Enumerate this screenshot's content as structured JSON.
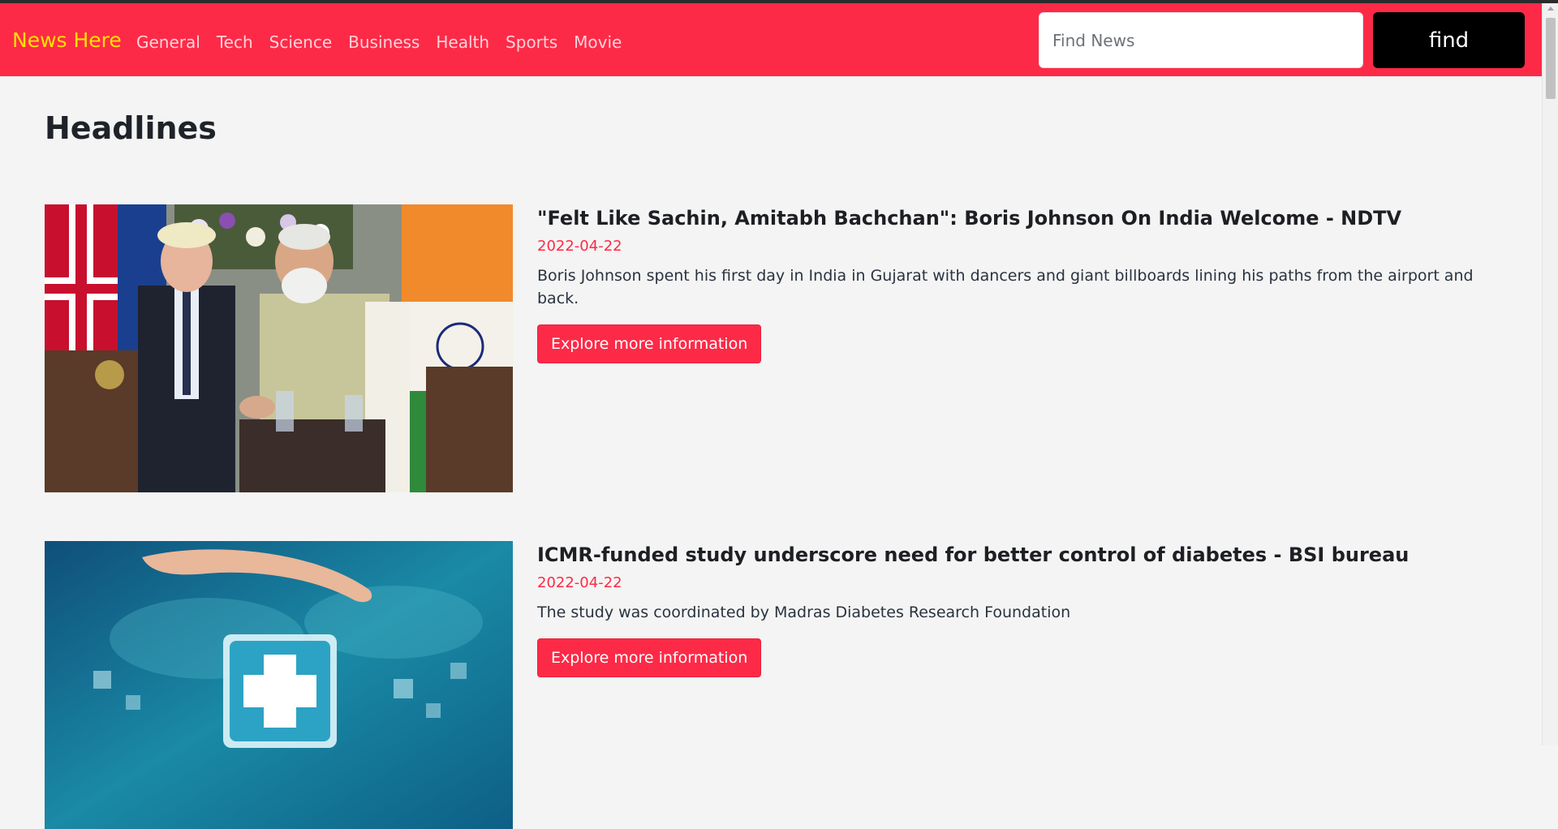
{
  "navbar": {
    "brand": "News Here",
    "links": [
      "General",
      "Tech",
      "Science",
      "Business",
      "Health",
      "Sports",
      "Movie"
    ],
    "search": {
      "placeholder": "Find News",
      "value": ""
    },
    "find_label": "find",
    "colors": {
      "background": "#fd2a47",
      "brand": "#ffe000",
      "find_button": "#000000"
    }
  },
  "main": {
    "title": "Headlines",
    "articles": [
      {
        "title": "\"Felt Like Sachin, Amitabh Bachchan\": Boris Johnson On India Welcome - NDTV",
        "date": "2022-04-22",
        "description": "Boris Johnson spent his first day in India in Gujarat with dancers and giant billboards lining his paths from the airport and back.",
        "button": "Explore more information"
      },
      {
        "title": "ICMR-funded study underscore need for better control of diabetes - BSI bureau",
        "date": "2022-04-22",
        "description": "The study was coordinated by Madras Diabetes Research Foundation",
        "button": "Explore more information"
      }
    ]
  }
}
